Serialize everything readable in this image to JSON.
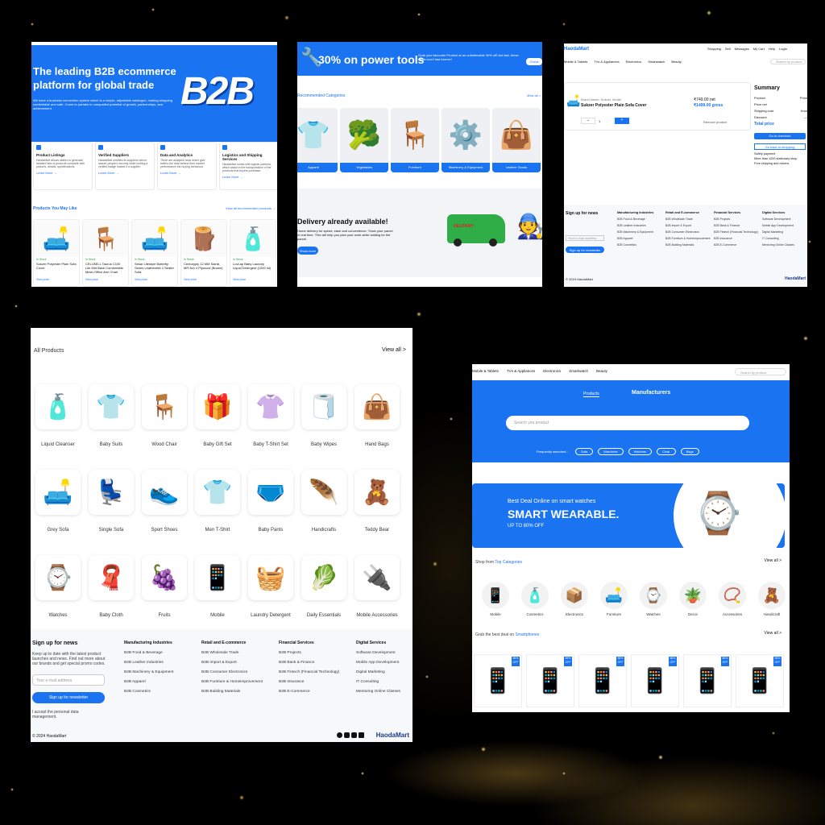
{
  "s1": {
    "hero_title": "The leading B2B ecommerce platform for global trade",
    "hero_text": "We have a business connection system which is a simple, adjustable catalogue, making shopping comfortable and safe. Come to partake in unequalled potential of growth, partnerships, and achievement.",
    "logo": "B2B",
    "features": [
      {
        "icon": "tag-icon",
        "title": "Product Listings",
        "text": "HaodaMart allows sellers to generate detailed lists of products complete with pictures, details, specifications.",
        "link": "Learn More →"
      },
      {
        "icon": "verified-icon",
        "title": "Verified Suppliers",
        "text": "HaodaMart certifies its suppliers which assure people's security while looking a verified badge makes it a supplier.",
        "link": "Learn More →"
      },
      {
        "icon": "chart-icon",
        "title": "Data and Analytics",
        "text": "There are analytics tools which give sellers the data behind their market performance the buying behaviour.",
        "link": "Learn More →"
      },
      {
        "icon": "truck-icon",
        "title": "Logistics and Shipping Services",
        "text": "HaodaMart works with logistic partners, which assist in the transportation of the products that buyers purchase.",
        "link": "Learn More →"
      }
    ],
    "products_title": "Products You May Like",
    "view_all": "View all recommended products →",
    "products": [
      {
        "emoji": "🛋️",
        "name": "Sukzer Polyester Plain Sofa Cover",
        "stock": "In Stock"
      },
      {
        "emoji": "🪑",
        "name": "CELLBELL Taurus C100 Lite Mid Back Comfortable Mesh Office Arm Chair",
        "stock": "In Stock"
      },
      {
        "emoji": "🛋️",
        "name": "Sekar Lifestyle Butterfly Series Leatherette 2 Seater Sofa",
        "stock": "In Stock"
      },
      {
        "emoji": "🪵",
        "name": "Centuryply 12 MM Sainik MR 8x4 4 Plywood (Brown)",
        "stock": "In Stock"
      },
      {
        "emoji": "🧴",
        "name": "LuvLap Baby Laundry Liquid Detergent (1000 ml)",
        "stock": "In Stock"
      }
    ],
    "view_price": "View price"
  },
  "s2": {
    "promo": "30% on power tools",
    "promo_text": "Grab your favourite Product at an unbelievable 30% off! Act fast, these deals won't last forever!",
    "promo_btn": "Check",
    "cat_title": "Recommended Categories",
    "cat_view": "View all >",
    "cats": [
      {
        "emoji": "👕",
        "label": "Apparel"
      },
      {
        "emoji": "🥦",
        "label": "Vegetables"
      },
      {
        "emoji": "🪑",
        "label": "Furniture"
      },
      {
        "emoji": "⚙️",
        "label": "Machinery & Equipment"
      },
      {
        "emoji": "👜",
        "label": "Leather Goods"
      }
    ],
    "delivery_title": "Delivery already available!",
    "delivery_text": "Home delivery for speed, ease and convenience. Track your parcel in real time. This will help you plan your work while waiting for the parcel.",
    "delivery_btn": "Show more",
    "van_label": "DELIVERY"
  },
  "s3": {
    "logo": "HaodaMart",
    "nav": [
      "Shopping",
      "Sell",
      "Messages",
      "My Cart",
      "Help",
      "Login"
    ],
    "menu": [
      "Mobile & Tablets",
      "TVs & Appliances",
      "Electronics",
      "Smartwatch",
      "Beauty"
    ],
    "search": "Search by product",
    "item_brand": "Brand Name: Sukzer, Model",
    "item_name": "Sukzer Polyester Plain Sofa Cover",
    "price_net": "₹749.00 net",
    "price_gross": "₹1499.00 gross",
    "qty": "1",
    "remove": "Remove product",
    "summary": "Summary",
    "rows": [
      {
        "k": "Product",
        "v": "Price"
      },
      {
        "k": "Price net",
        "v": ""
      },
      {
        "k": "Shipping cost",
        "v": "from"
      },
      {
        "k": "Discount",
        "v": "—"
      }
    ],
    "total_label": "Total price",
    "checkout": "Go to checkout",
    "back": "Go back to shopping",
    "perks": [
      "Safety payment",
      "More than 1000 stationary shop",
      "Free shipping and returns"
    ],
    "signup": "Sign up for news",
    "footer_cols": [
      {
        "h": "Manufacturing Industries",
        "items": [
          "B2B Food & Beverage",
          "B2B Leather Industries",
          "B2B Machinery & Equipment",
          "B2B Apparel",
          "B2B Cosmetics"
        ]
      },
      {
        "h": "Retail and E-commerce",
        "items": [
          "B2B Wholesale Trade",
          "B2B Import & Export",
          "B2B Consumer Electronics",
          "B2B Furniture & Homeimprovement",
          "B2B Building Materials"
        ]
      },
      {
        "h": "Financial Services",
        "items": [
          "B2B Projects",
          "B2B Bank & Finance",
          "B2B Fintech (Financial Technology)",
          "B2B Insurance",
          "B2B E-Commerce"
        ]
      },
      {
        "h": "Digital Services",
        "items": [
          "Software Development",
          "Mobile App Development",
          "Digital Marketing",
          "IT Consulting",
          "Mentoring Online Classes"
        ]
      }
    ],
    "email_ph": "Your e-mail address",
    "signup_btn": "Sign up for newsletter",
    "copyright": "© 2024 HaodaMart",
    "footer_logo": "HaodaMart"
  },
  "s4": {
    "title": "All Products",
    "view_all": "View all >",
    "products": [
      {
        "emoji": "🧴",
        "label": "Liquid Cleanser"
      },
      {
        "emoji": "👕",
        "label": "Baby Suits"
      },
      {
        "emoji": "🪑",
        "label": "Wood Chair"
      },
      {
        "emoji": "🎁",
        "label": "Baby Gift Set"
      },
      {
        "emoji": "👚",
        "label": "Baby T-Shirt Set"
      },
      {
        "emoji": "🧻",
        "label": "Baby Wipes"
      },
      {
        "emoji": "👜",
        "label": "Hand Bags"
      },
      {
        "emoji": "🛋️",
        "label": "Grey Sofa"
      },
      {
        "emoji": "💺",
        "label": "Single Sofa"
      },
      {
        "emoji": "👟",
        "label": "Sport Shoes"
      },
      {
        "emoji": "👕",
        "label": "Men T-Shirt"
      },
      {
        "emoji": "🩲",
        "label": "Baby Pants"
      },
      {
        "emoji": "🪶",
        "label": "Handicrafts"
      },
      {
        "emoji": "🧸",
        "label": "Teddy Bear"
      },
      {
        "emoji": "⌚",
        "label": "Watches"
      },
      {
        "emoji": "🧣",
        "label": "Baby Cloth"
      },
      {
        "emoji": "🍇",
        "label": "Fruits"
      },
      {
        "emoji": "📱",
        "label": "Mobile"
      },
      {
        "emoji": "🧺",
        "label": "Laundry Detergent"
      },
      {
        "emoji": "🥬",
        "label": "Daily Essentials"
      },
      {
        "emoji": "🔌",
        "label": "Mobile Accessories"
      }
    ],
    "signup_title": "Sign up for news",
    "signup_text": "Keep up to date with the latest product launches and news. Find out more about our brands and get special promo codes.",
    "email_ph": "Your e-mail address",
    "signup_btn": "Sign up for newsletter",
    "consent": "I accept the personal data management.",
    "footer_cols": [
      {
        "h": "Manufacturing Industries",
        "items": [
          "B2B Food & Beverage",
          "B2B Leather Industries",
          "B2B Machinery & Equipment",
          "B2B Apparel",
          "B2B Cosmetics"
        ]
      },
      {
        "h": "Retail and E-commerce",
        "items": [
          "B2B Wholesale Trade",
          "B2B Import & Export",
          "B2B Consumer Electronics",
          "B2B Furniture & Homeimprovement",
          "B2B Building Materials"
        ]
      },
      {
        "h": "Financial Services",
        "items": [
          "B2B Projects",
          "B2B Bank & Finance",
          "B2B Fintech (Financial Technology)",
          "B2B Insurance",
          "B2B E-Commerce"
        ]
      },
      {
        "h": "Digital Services",
        "items": [
          "Software Development",
          "Mobile App Development",
          "Digital Marketing",
          "IT Consulting",
          "Mentoring Online Classes"
        ]
      }
    ],
    "copyright": "© 2024 HaodaMart",
    "footer_logo": "HaodaMart"
  },
  "s5": {
    "menu": [
      "Mobile & Tablets",
      "TVs & Appliances",
      "Electronics",
      "Smartwatch",
      "Beauty"
    ],
    "search": "Search by product",
    "tab_products": "Products",
    "tab_manufacturers": "Manufacturers",
    "hero_search": "Search you product",
    "freq_label": "Frequently searched :",
    "chips": [
      "Sofa",
      "Wardrobe",
      "Watches",
      "Chair",
      "Bags"
    ],
    "banner_sub": "Best Deal Online on smart watches",
    "banner_title": "SMART WEARABLE.",
    "banner_off": "UP TO 80% OFF",
    "shop_from": "Shop from",
    "top_cat": "Top Categories",
    "view_all": "View all >",
    "cats": [
      {
        "emoji": "📱",
        "label": "Mobile"
      },
      {
        "emoji": "🧴",
        "label": "Cosmetics"
      },
      {
        "emoji": "📦",
        "label": "Electronics"
      },
      {
        "emoji": "🛋️",
        "label": "Furniture"
      },
      {
        "emoji": "⌚",
        "label": "Watches"
      },
      {
        "emoji": "🪴",
        "label": "Decor"
      },
      {
        "emoji": "📿",
        "label": "Accessories"
      },
      {
        "emoji": "🧸",
        "label": "Handicraft"
      }
    ],
    "deal_prefix": "Grab the best deal on",
    "deal_link": "Smartphones",
    "view_all2": "View all >",
    "phones": [
      "📱",
      "📱",
      "📱",
      "📱",
      "📱",
      "📱"
    ],
    "badge": "56% OFF"
  }
}
